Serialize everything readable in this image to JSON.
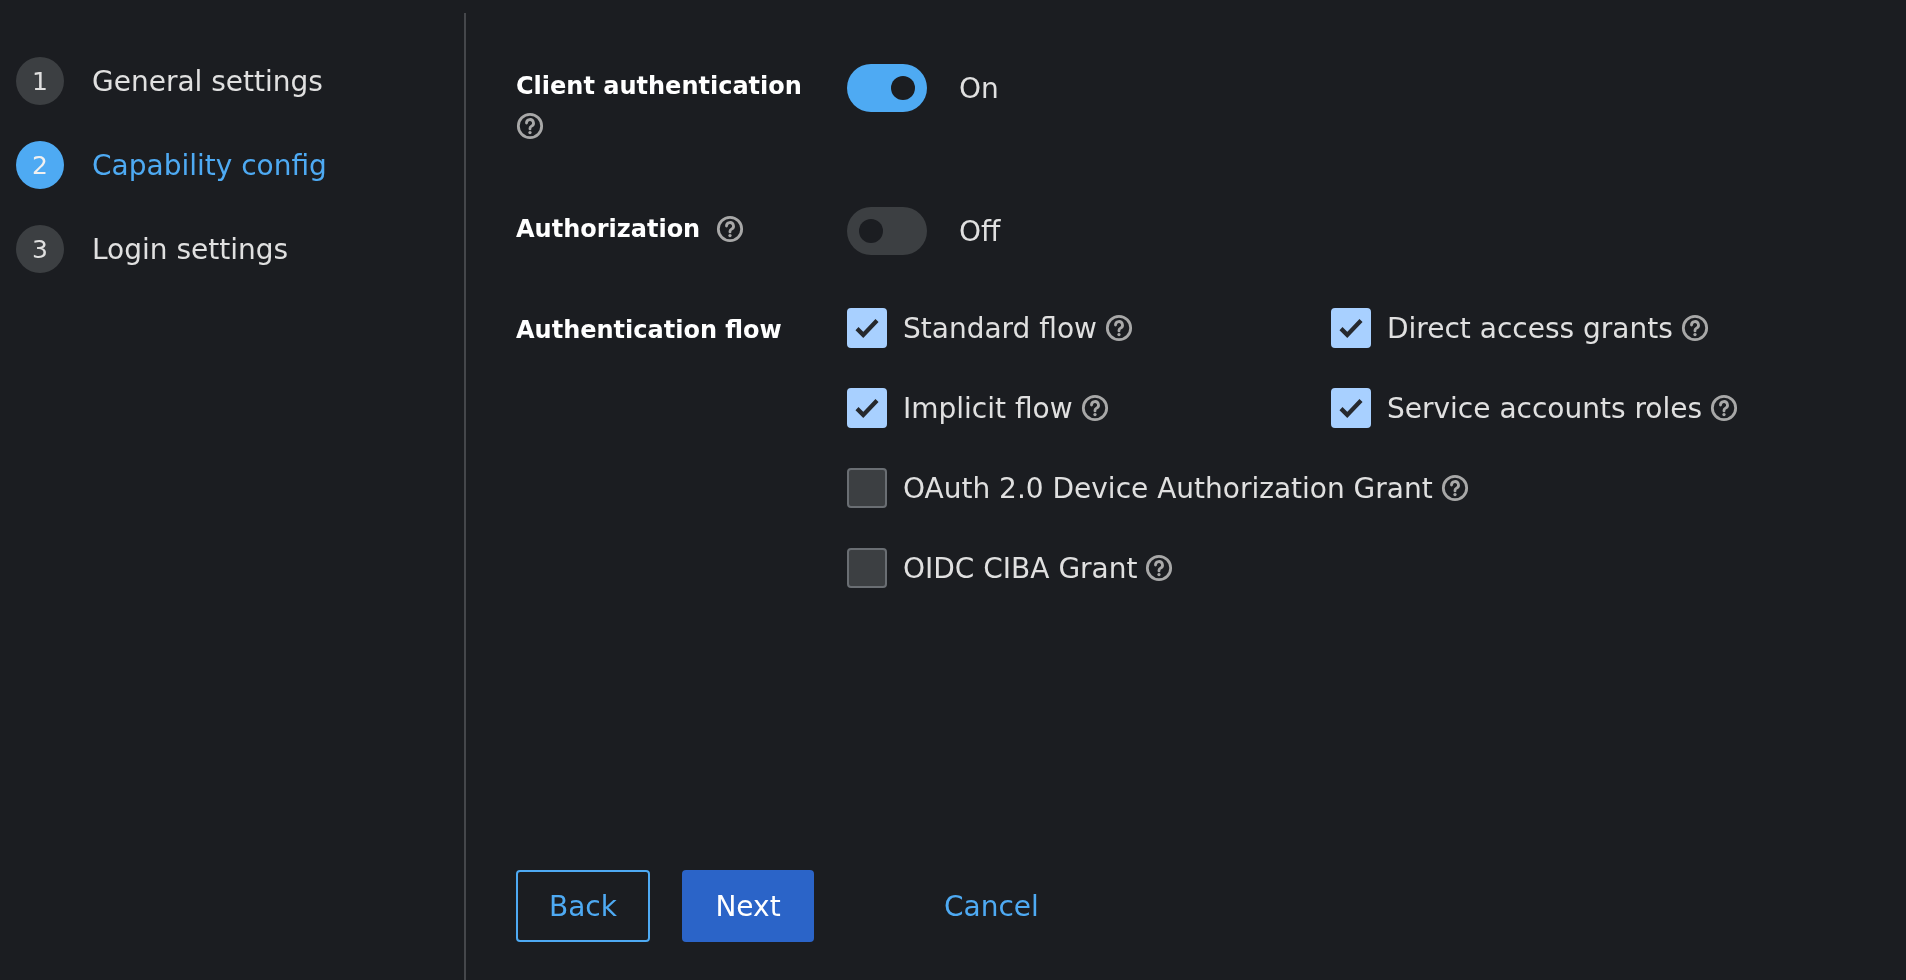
{
  "steps": [
    {
      "number": "1",
      "label": "General settings",
      "selected": false
    },
    {
      "number": "2",
      "label": "Capability config",
      "selected": true
    },
    {
      "number": "3",
      "label": "Login settings",
      "selected": false
    }
  ],
  "toggles": [
    {
      "label": "Client authentication",
      "on": true,
      "state_text": "On"
    },
    {
      "label": "Authorization",
      "on": false,
      "state_text": "Off"
    }
  ],
  "authentication_flow": {
    "label": "Authentication flow",
    "options": [
      {
        "label": "Standard flow",
        "checked": true
      },
      {
        "label": "Direct access grants",
        "checked": true
      },
      {
        "label": "Implicit flow",
        "checked": true
      },
      {
        "label": "Service accounts roles",
        "checked": true
      },
      {
        "label": "OAuth 2.0 Device Authorization Grant",
        "checked": false
      },
      {
        "label": "OIDC CIBA Grant",
        "checked": false
      }
    ]
  },
  "buttons": [
    {
      "label": "Back",
      "kind": "secondary"
    },
    {
      "label": "Next",
      "kind": "primary"
    },
    {
      "label": "Cancel",
      "kind": "link"
    }
  ]
}
